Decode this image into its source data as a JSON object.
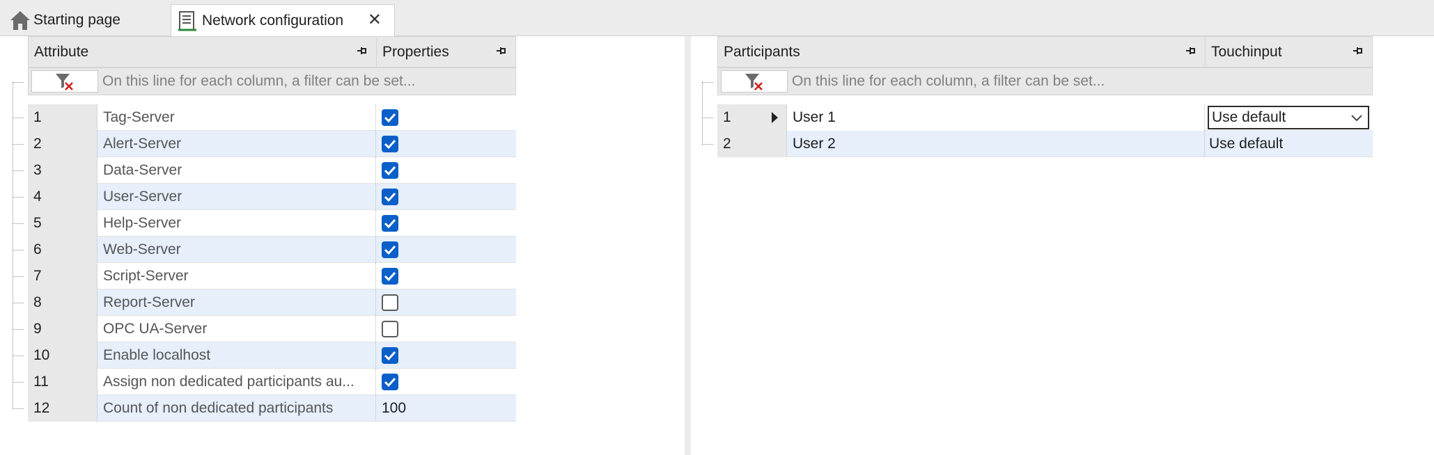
{
  "tabs": [
    {
      "label": "Starting page",
      "icon": "home-icon"
    },
    {
      "label": "Network configuration",
      "icon": "network-config-icon",
      "active": true,
      "close_icon": "close-icon"
    }
  ],
  "left_grid": {
    "columns": [
      "Attribute",
      "Properties"
    ],
    "filter_placeholder": "On this line for each column, a filter can be set...",
    "rows": [
      {
        "num": "1",
        "attribute": "Tag-Server",
        "type": "checkbox",
        "checked": true
      },
      {
        "num": "2",
        "attribute": "Alert-Server",
        "type": "checkbox",
        "checked": true
      },
      {
        "num": "3",
        "attribute": "Data-Server",
        "type": "checkbox",
        "checked": true
      },
      {
        "num": "4",
        "attribute": "User-Server",
        "type": "checkbox",
        "checked": true
      },
      {
        "num": "5",
        "attribute": "Help-Server",
        "type": "checkbox",
        "checked": true
      },
      {
        "num": "6",
        "attribute": "Web-Server",
        "type": "checkbox",
        "checked": true
      },
      {
        "num": "7",
        "attribute": "Script-Server",
        "type": "checkbox",
        "checked": true
      },
      {
        "num": "8",
        "attribute": "Report-Server",
        "type": "checkbox",
        "checked": false
      },
      {
        "num": "9",
        "attribute": "OPC UA-Server",
        "type": "checkbox",
        "checked": false
      },
      {
        "num": "10",
        "attribute": "Enable localhost",
        "type": "checkbox",
        "checked": true
      },
      {
        "num": "11",
        "attribute": "Assign non dedicated participants au...",
        "type": "checkbox",
        "checked": true
      },
      {
        "num": "12",
        "attribute": "Count of non dedicated participants",
        "type": "text",
        "value": "100"
      }
    ]
  },
  "right_grid": {
    "columns": [
      "Participants",
      "Touchinput"
    ],
    "filter_placeholder": "On this line for each column, a filter can be set...",
    "rows": [
      {
        "num": "1",
        "participant": "User 1",
        "touchinput": "Use default",
        "selected": true
      },
      {
        "num": "2",
        "participant": "User 2",
        "touchinput": "Use default",
        "selected": false
      }
    ]
  },
  "colors": {
    "checkbox_on": "#0a5fc8",
    "alt_row": "#e6effa",
    "header_bg": "#e8e8e8"
  }
}
